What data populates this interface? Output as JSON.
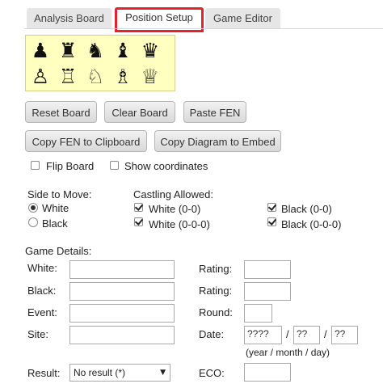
{
  "tabs": [
    {
      "label": "Analysis Board"
    },
    {
      "label": "Position Setup"
    },
    {
      "label": "Game Editor"
    }
  ],
  "palette": {
    "black": [
      "♟",
      "♜",
      "♞",
      "♝",
      "♛"
    ],
    "white": [
      "♙",
      "♖",
      "♘",
      "♗",
      "♕"
    ],
    "black_icons": [
      "black-pawn-icon",
      "black-rook-icon",
      "black-knight-icon",
      "black-bishop-icon",
      "black-queen-icon"
    ],
    "white_icons": [
      "white-pawn-icon",
      "white-rook-icon",
      "white-knight-icon",
      "white-bishop-icon",
      "white-queen-icon"
    ]
  },
  "buttons": {
    "reset": "Reset Board",
    "clear": "Clear Board",
    "paste": "Paste FEN",
    "copy_fen": "Copy FEN to Clipboard",
    "copy_diagram": "Copy Diagram to Embed"
  },
  "options": {
    "flip_board": "Flip Board",
    "show_coordinates": "Show coordinates"
  },
  "side_to_move": {
    "title": "Side to Move:",
    "white": "White",
    "black": "Black",
    "selected": "White"
  },
  "castling": {
    "title": "Castling Allowed:",
    "white_short": "White (0-0)",
    "white_long": "White (0-0-0)",
    "black_short": "Black (0-0)",
    "black_long": "Black (0-0-0)"
  },
  "game_details": {
    "title": "Game Details:",
    "white_label": "White:",
    "black_label": "Black:",
    "event_label": "Event:",
    "site_label": "Site:",
    "result_label": "Result:",
    "rating_label": "Rating:",
    "rating2_label": "Rating:",
    "round_label": "Round:",
    "date_label": "Date:",
    "eco_label": "ECO:",
    "date_year": "????",
    "date_month": "??",
    "date_day": "??",
    "date_sep": "/",
    "date_hint": "(year / month / day)",
    "result_value": "No result (*)",
    "result_arrow": "▼"
  }
}
